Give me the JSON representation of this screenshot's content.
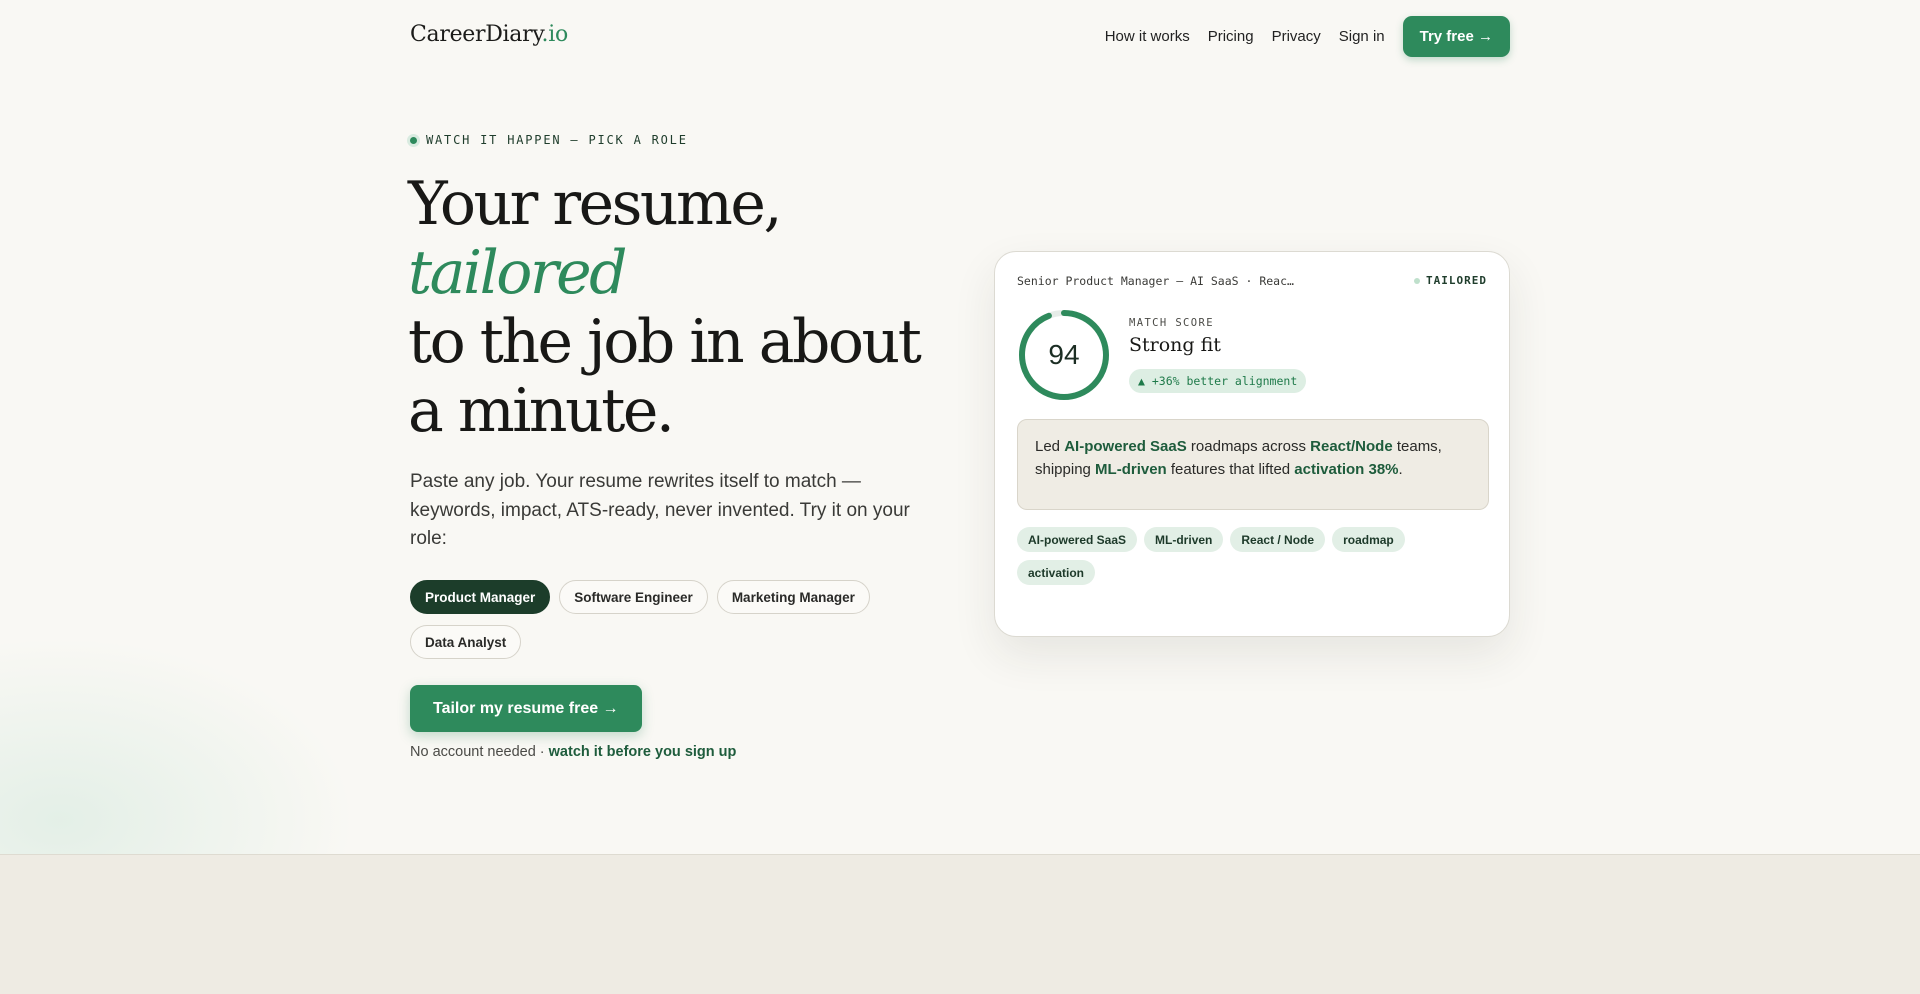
{
  "header": {
    "logo_main": "CareerDiary",
    "logo_tld": ".io",
    "nav": [
      "How it works",
      "Pricing",
      "Privacy",
      "Sign in"
    ],
    "cta_label": "Try free →"
  },
  "hero": {
    "eyebrow": "WATCH IT HAPPEN — PICK A ROLE",
    "headline_line1": "Your resume,",
    "headline_accent": "tailored",
    "headline_line3": "to the job in about a minute.",
    "lede": "Paste any job. Your resume rewrites itself to match — keywords, impact, ATS-ready, never invented. Try it on your role:",
    "roles": [
      "Product Manager",
      "Software Engineer",
      "Marketing Manager",
      "Data Analyst"
    ],
    "selected_role": "Product Manager",
    "cta_label": "Tailor my resume free →",
    "note_prefix": "No account needed ·",
    "note_link": "watch it before you sign up"
  },
  "preview": {
    "job_title": "Senior Product Manager — AI SaaS · Reac…",
    "status": "TAILORED",
    "match_label": "MATCH SCORE",
    "match_score": "94",
    "match_fraction": 0.94,
    "match_verdict": "Strong fit",
    "delta": "▲ +36% better alignment",
    "bullet": {
      "t1": "Led ",
      "k1": "AI-powered SaaS",
      "t2": " roadmaps across ",
      "k2": "React/Node",
      "t3": " teams, shipping ",
      "k3": "ML-driven",
      "t4": " features that lifted ",
      "k4": "activation 38%",
      "t5": "."
    },
    "keywords": [
      "AI-powered SaaS",
      "ML-driven",
      "React / Node",
      "roadmap",
      "activation"
    ]
  },
  "colors": {
    "accent": "#2e8a5c",
    "accent_dark": "#1c3d2a",
    "background": "#f9f8f4"
  }
}
